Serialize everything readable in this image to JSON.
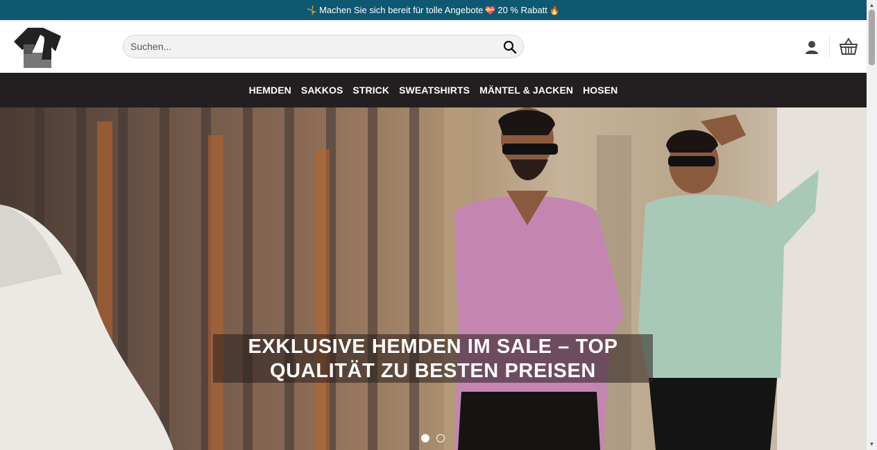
{
  "announcement": {
    "emoji_left": "🤸",
    "text": "Machen Sie sich bereit für tolle Angebote",
    "emoji_mid": "💝",
    "discount": "20 % Rabatt",
    "emoji_right": "🔥"
  },
  "header": {
    "search_placeholder": "Suchen..."
  },
  "nav": {
    "items": [
      "HEMDEN",
      "SAKKOS",
      "STRICK",
      "SWEATSHIRTS",
      "MÄNTEL & JACKEN",
      "HOSEN"
    ]
  },
  "hero": {
    "caption_line1": "EXKLUSIVE HEMDEN IM SALE – TOP",
    "caption_line2": "QUALITÄT ZU BESTEN PREISEN",
    "slide_count": 2,
    "active_slide": 1
  },
  "colors": {
    "announcement_bg": "#0e5872",
    "nav_bg": "#231f20"
  }
}
